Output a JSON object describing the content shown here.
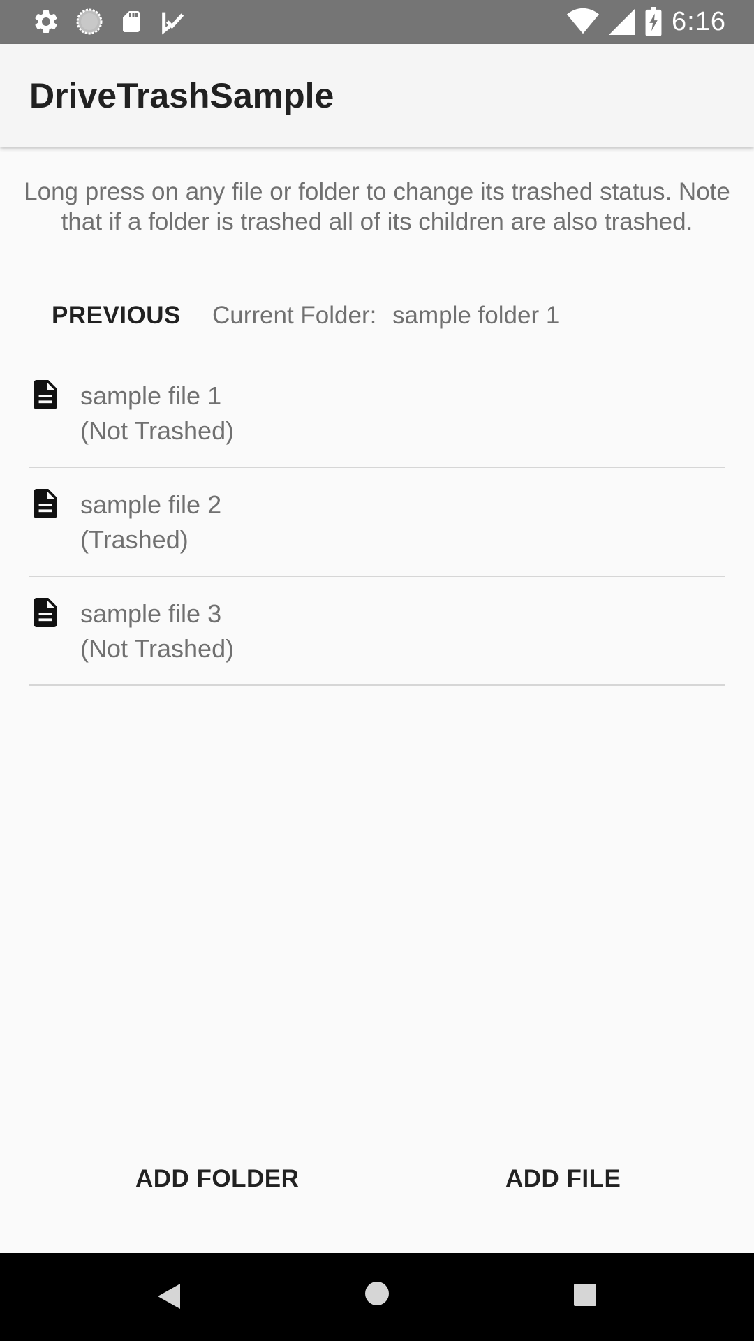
{
  "status_bar": {
    "time": "6:16",
    "left_icons": [
      "settings-icon",
      "sync-icon",
      "sd-card-icon",
      "check-icon"
    ],
    "right_icons": [
      "wifi-icon",
      "signal-icon",
      "battery-charging-icon"
    ]
  },
  "app_bar": {
    "title": "DriveTrashSample"
  },
  "instructions": "Long press on any file or folder to change its trashed status. Note that if a folder is trashed all of its children are also trashed.",
  "nav": {
    "previous_label": "PREVIOUS",
    "current_folder_label": "Current Folder:",
    "current_folder_name": "sample folder 1"
  },
  "files": [
    {
      "name": "sample file 1",
      "status": "(Not Trashed)",
      "icon": "file-icon"
    },
    {
      "name": "sample file 2",
      "status": "(Trashed)",
      "icon": "file-icon"
    },
    {
      "name": "sample file 3",
      "status": "(Not Trashed)",
      "icon": "file-icon"
    }
  ],
  "actions": {
    "add_folder_label": "ADD FOLDER",
    "add_file_label": "ADD FILE"
  },
  "system_nav": {
    "icons": [
      "back-icon",
      "home-icon",
      "recents-icon"
    ]
  },
  "colors": {
    "status_bar": "#757575",
    "app_bar": "#f5f5f5",
    "background": "#fafafa",
    "nav_bar": "#000000"
  }
}
